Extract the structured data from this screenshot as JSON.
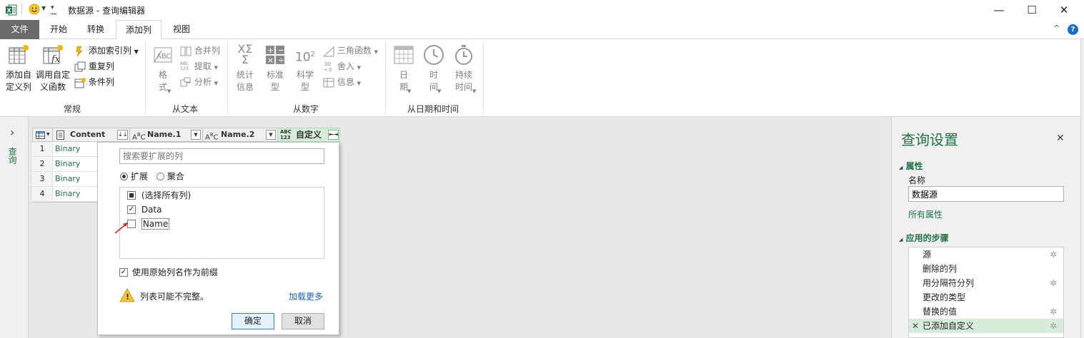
{
  "window": {
    "title": "数据源 - 查询编辑器",
    "minimize": "—",
    "maximize": "☐",
    "close": "✕",
    "help": "?",
    "collapse_ribbon": "^"
  },
  "menu": {
    "tabs": [
      "文件",
      "开始",
      "转换",
      "添加列",
      "视图"
    ],
    "active": "添加列"
  },
  "ribbon": {
    "groups": {
      "general": {
        "label": "常规",
        "custom_column": "添加自\n定义列",
        "custom_function": "调用自定\n义函数",
        "index_column": "添加索引列",
        "duplicate_column": "重复列",
        "conditional_column": "条件列"
      },
      "from_text": {
        "label": "从文本",
        "format": "格\n式",
        "merge_columns": "合并列",
        "extract": "提取",
        "parse": "分析"
      },
      "from_number": {
        "label": "从数字",
        "statistics": "统计\n信息",
        "standard": "标准\n型",
        "scientific": "科学\n型",
        "trigonometry": "三角函数",
        "rounding": "舍入",
        "information": "信息"
      },
      "from_datetime": {
        "label": "从日期和时间",
        "date": "日\n期",
        "time": "时\n间",
        "duration": "持续\n时间"
      }
    }
  },
  "left_pane": {
    "expand": "›",
    "label": "查询"
  },
  "grid": {
    "columns": [
      {
        "name": "Content",
        "type_icon": "doc-icon"
      },
      {
        "name": "Name.1",
        "type_icon": "abc-icon"
      },
      {
        "name": "Name.2",
        "type_icon": "abc-icon"
      },
      {
        "name": "自定义",
        "type_icon": "abc123-icon"
      }
    ],
    "rows": [
      {
        "num": "1",
        "content": "Binary"
      },
      {
        "num": "2",
        "content": "Binary"
      },
      {
        "num": "3",
        "content": "Binary"
      },
      {
        "num": "4",
        "content": "Binary"
      }
    ]
  },
  "expand_popup": {
    "search_placeholder": "搜索要扩展的列",
    "radio_expand": "扩展",
    "radio_aggregate": "聚合",
    "selected_mode": "扩展",
    "items": [
      {
        "label": "(选择所有列)",
        "state": "partial"
      },
      {
        "label": "Data",
        "state": "checked"
      },
      {
        "label": "Name",
        "state": "unchecked"
      }
    ],
    "prefix_checkbox": "使用原始列名作为前缀",
    "prefix_checked": true,
    "warning": "列表可能不完整。",
    "load_more": "加载更多",
    "ok": "确定",
    "cancel": "取消"
  },
  "query_settings": {
    "title": "查询设置",
    "close": "✕",
    "properties_header": "属性",
    "name_label": "名称",
    "name_value": "数据源",
    "all_properties": "所有属性",
    "steps_header": "应用的步骤",
    "steps": [
      {
        "label": "源",
        "gear": true
      },
      {
        "label": "删除的列",
        "gear": false
      },
      {
        "label": "用分隔符分列",
        "gear": true
      },
      {
        "label": "更改的类型",
        "gear": false
      },
      {
        "label": "替换的值",
        "gear": true
      },
      {
        "label": "已添加自定义",
        "gear": true,
        "selected": true
      }
    ]
  },
  "colors": {
    "accent_green": "#217346",
    "link_blue": "#1a5fb4",
    "selected_step": "#d8ecdc"
  }
}
